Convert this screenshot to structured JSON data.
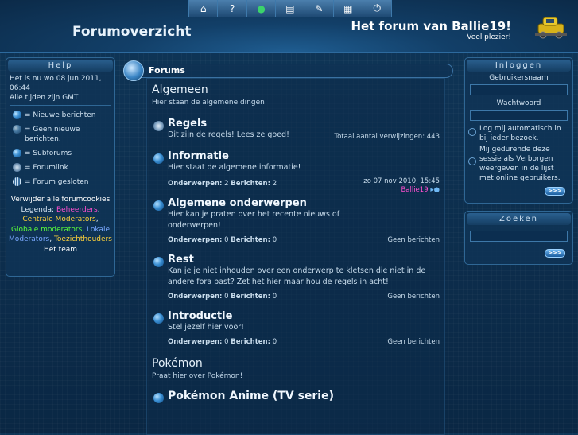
{
  "topbar": {
    "icons": [
      "home-icon",
      "help-icon",
      "globe-icon",
      "members-icon",
      "search-icon",
      "profile-icon",
      "power-icon"
    ],
    "glyphs": [
      "⌂",
      "?",
      "●",
      "▤",
      "✎",
      "▦",
      "⏻"
    ]
  },
  "header": {
    "page_title": "Forumoverzicht",
    "site_title": "Het forum van Ballie19!",
    "site_desc": "Veel plezier!"
  },
  "help": {
    "title": "Help",
    "now": "Het is nu wo 08 jun 2011, 06:44",
    "timezone": "Alle tijden zijn GMT",
    "legend": [
      {
        "label": "= Nieuwe berichten"
      },
      {
        "label": "= Geen nieuwe berichten."
      },
      {
        "label": "= Subforums"
      },
      {
        "label": "= Forumlink"
      },
      {
        "label": "= Forum gesloten"
      }
    ],
    "delete_cookies": "Verwijder alle forumcookies",
    "legend_label": "Legenda:",
    "groups": {
      "admins": "Beheerders",
      "central_mods": "Centrale Moderators",
      "global_mods": "Globale moderators",
      "local_mods": "Lokale Moderators",
      "supervisors": "Toezichthouders"
    },
    "team": "Het team",
    "colors": {
      "admins": "#ff4fd0",
      "central_mods": "#ffd23a",
      "global_mods": "#5bff3a",
      "local_mods": "#7aa8ff",
      "supervisors": "#ffd23a"
    }
  },
  "login": {
    "title": "Inloggen",
    "username_label": "Gebruikersnaam",
    "password_label": "Wachtwoord",
    "auto_login": "Log mij automatisch in bij ieder bezoek.",
    "hide_online": "Mij gedurende deze sessie als Verborgen weergeven in de lijst met online gebruikers.",
    "go": ">>>"
  },
  "search": {
    "title": "Zoeken",
    "go": ">>>"
  },
  "main": {
    "forums_label": "Forums",
    "categories": [
      {
        "title": "Algemeen",
        "desc": "Hier staan de algemene dingen",
        "forums": [
          {
            "name": "Regels",
            "desc": "Dit zijn de regels! Lees ze goed!",
            "right": "Totaal aantal verwijzingen: 443"
          },
          {
            "name": "Informatie",
            "desc": "Hier staat de algemene informatie!",
            "topics_label": "Onderwerpen:",
            "topics": "2",
            "posts_label": "Berichten:",
            "posts": "2",
            "last_date": "zo 07 nov 2010, 15:45",
            "last_user": "Ballie19"
          },
          {
            "name": "Algemene onderwerpen",
            "desc": "Hier kan je praten over het recente nieuws of onderwerpen!",
            "topics_label": "Onderwerpen:",
            "topics": "0",
            "posts_label": "Berichten:",
            "posts": "0",
            "right": "Geen berichten"
          },
          {
            "name": "Rest",
            "desc": "Kan je je niet inhouden over een onderwerp te kletsen die niet in de andere fora past? Zet het hier maar hou de regels in acht!",
            "topics_label": "Onderwerpen:",
            "topics": "0",
            "posts_label": "Berichten:",
            "posts": "0",
            "right": "Geen berichten"
          },
          {
            "name": "Introductie",
            "desc": "Stel jezelf hier voor!",
            "topics_label": "Onderwerpen:",
            "topics": "0",
            "posts_label": "Berichten:",
            "posts": "0",
            "right": "Geen berichten"
          }
        ]
      },
      {
        "title": "Pokémon",
        "desc": "Praat hier over Pokémon!",
        "forums": [
          {
            "name": "Pokémon Anime (TV serie)"
          }
        ]
      }
    ]
  }
}
